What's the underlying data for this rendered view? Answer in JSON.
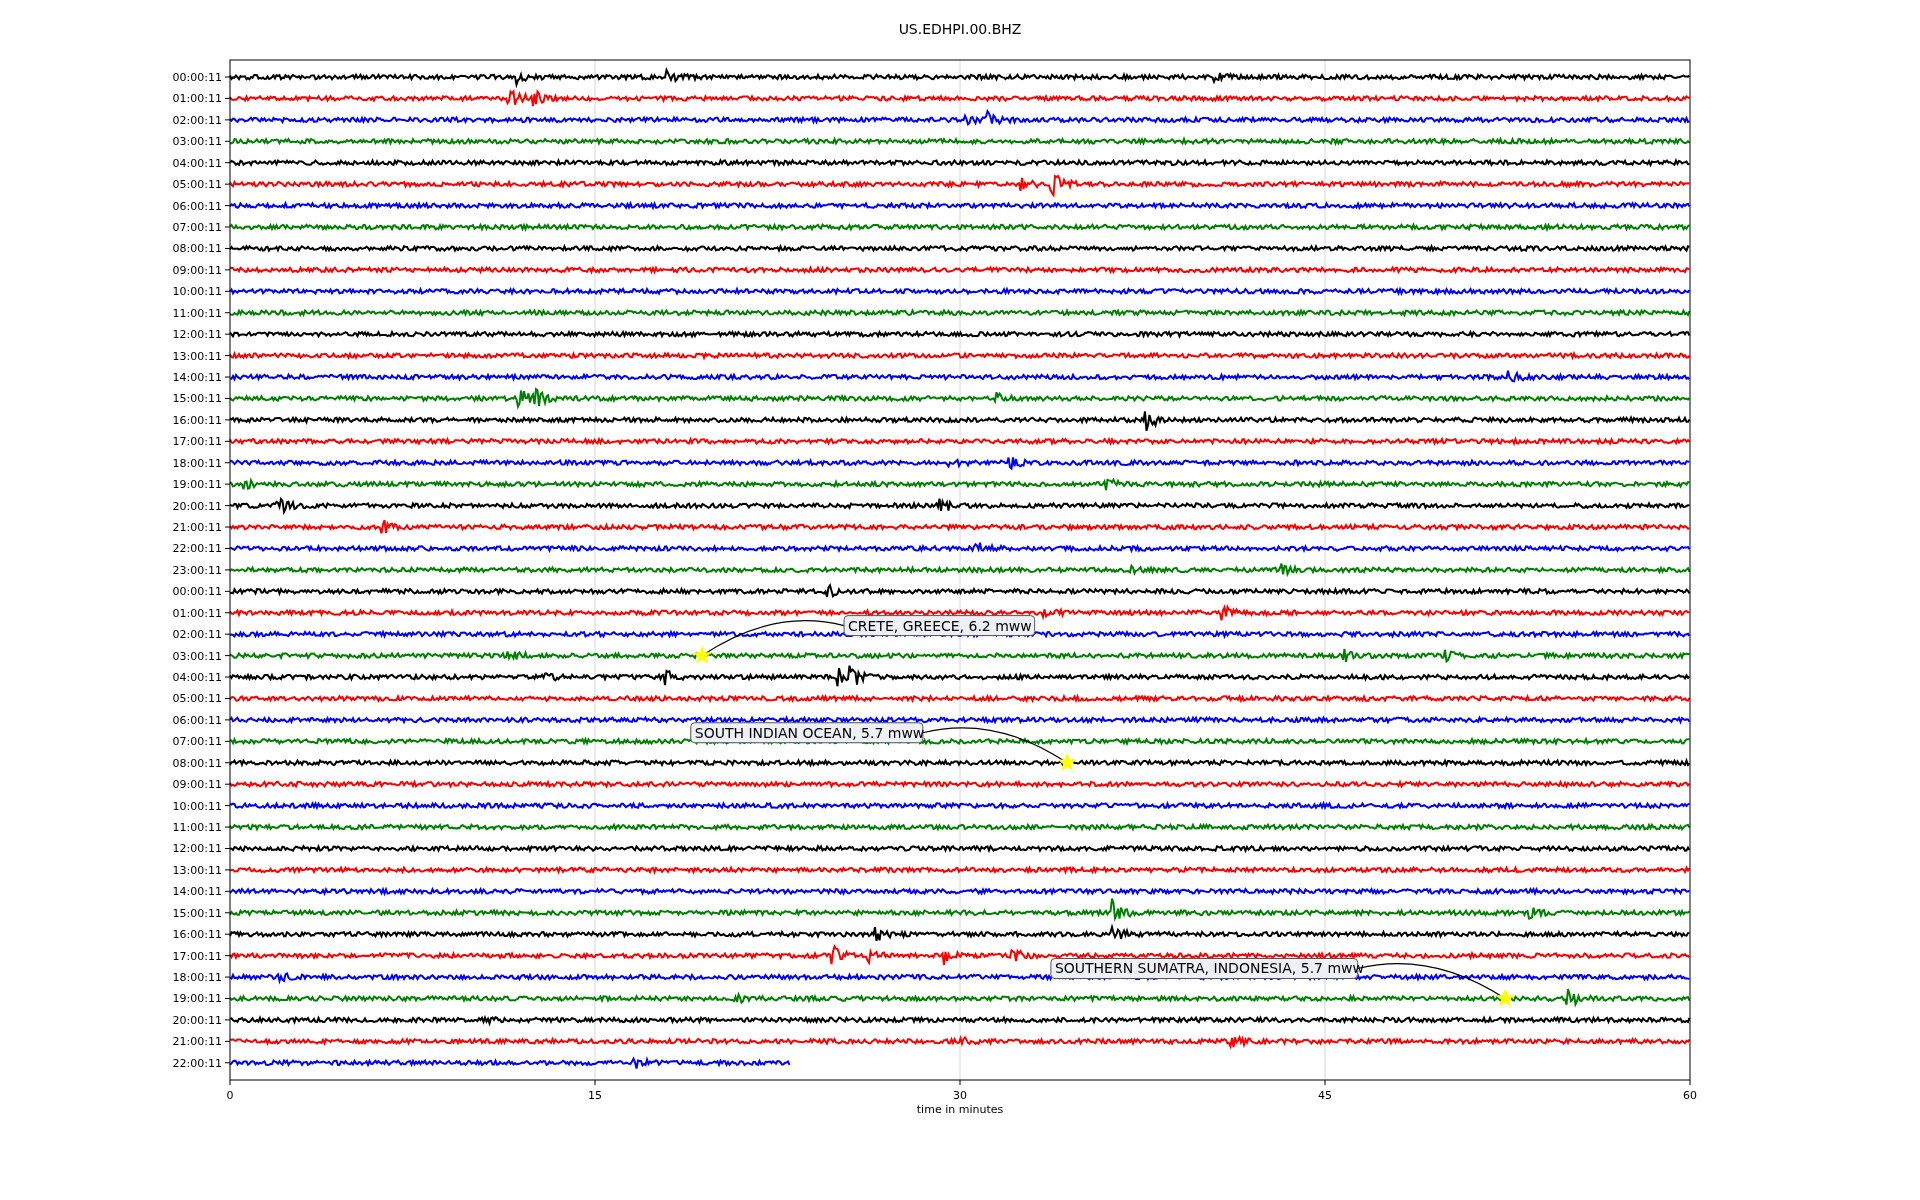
{
  "plot": {
    "title": "US.EDHPI.00.BHZ",
    "x_axis": {
      "label": "time in minutes",
      "ticks": [
        "0",
        "15",
        "30",
        "45",
        "60"
      ]
    }
  },
  "annotations": [
    {
      "text": "CRETE, GREECE, 6.2 mww"
    },
    {
      "text": "SOUTH INDIAN OCEAN, 5.7 mww"
    },
    {
      "text": "SOUTHERN SUMATRA, INDONESIA, 5.7 mww"
    }
  ],
  "traces": [
    {
      "label": "00:00:11",
      "color": "#000000"
    },
    {
      "label": "01:00:11",
      "color": "#ff0000"
    },
    {
      "label": "02:00:11",
      "color": "#0000ff"
    },
    {
      "label": "03:00:11",
      "color": "#008000"
    },
    {
      "label": "04:00:11",
      "color": "#000000"
    },
    {
      "label": "05:00:11",
      "color": "#ff0000"
    },
    {
      "label": "06:00:11",
      "color": "#0000ff"
    },
    {
      "label": "07:00:11",
      "color": "#008000"
    },
    {
      "label": "08:00:11",
      "color": "#000000"
    },
    {
      "label": "09:00:11",
      "color": "#ff0000"
    },
    {
      "label": "10:00:11",
      "color": "#0000ff"
    },
    {
      "label": "11:00:11",
      "color": "#008000"
    },
    {
      "label": "12:00:11",
      "color": "#000000"
    },
    {
      "label": "13:00:11",
      "color": "#ff0000"
    },
    {
      "label": "14:00:11",
      "color": "#0000ff"
    },
    {
      "label": "15:00:11",
      "color": "#008000"
    },
    {
      "label": "16:00:11",
      "color": "#000000"
    },
    {
      "label": "17:00:11",
      "color": "#ff0000"
    },
    {
      "label": "18:00:11",
      "color": "#0000ff"
    },
    {
      "label": "19:00:11",
      "color": "#008000"
    },
    {
      "label": "20:00:11",
      "color": "#000000"
    },
    {
      "label": "21:00:11",
      "color": "#ff0000"
    },
    {
      "label": "22:00:11",
      "color": "#0000ff"
    },
    {
      "label": "23:00:11",
      "color": "#008000"
    },
    {
      "label": "00:00:11",
      "color": "#000000"
    },
    {
      "label": "01:00:11",
      "color": "#ff0000"
    },
    {
      "label": "02:00:11",
      "color": "#0000ff"
    },
    {
      "label": "03:00:11",
      "color": "#008000"
    },
    {
      "label": "04:00:11",
      "color": "#000000"
    },
    {
      "label": "05:00:11",
      "color": "#ff0000"
    },
    {
      "label": "06:00:11",
      "color": "#0000ff"
    },
    {
      "label": "07:00:11",
      "color": "#008000"
    },
    {
      "label": "08:00:11",
      "color": "#000000"
    },
    {
      "label": "09:00:11",
      "color": "#ff0000"
    },
    {
      "label": "10:00:11",
      "color": "#0000ff"
    },
    {
      "label": "11:00:11",
      "color": "#008000"
    },
    {
      "label": "12:00:11",
      "color": "#000000"
    },
    {
      "label": "13:00:11",
      "color": "#ff0000"
    },
    {
      "label": "14:00:11",
      "color": "#0000ff"
    },
    {
      "label": "15:00:11",
      "color": "#008000"
    },
    {
      "label": "16:00:11",
      "color": "#000000"
    },
    {
      "label": "17:00:11",
      "color": "#ff0000"
    },
    {
      "label": "18:00:11",
      "color": "#0000ff"
    },
    {
      "label": "19:00:11",
      "color": "#008000"
    },
    {
      "label": "20:00:11",
      "color": "#000000"
    },
    {
      "label": "21:00:11",
      "color": "#ff0000"
    },
    {
      "label": "22:00:11",
      "color": "#0000ff"
    }
  ]
}
